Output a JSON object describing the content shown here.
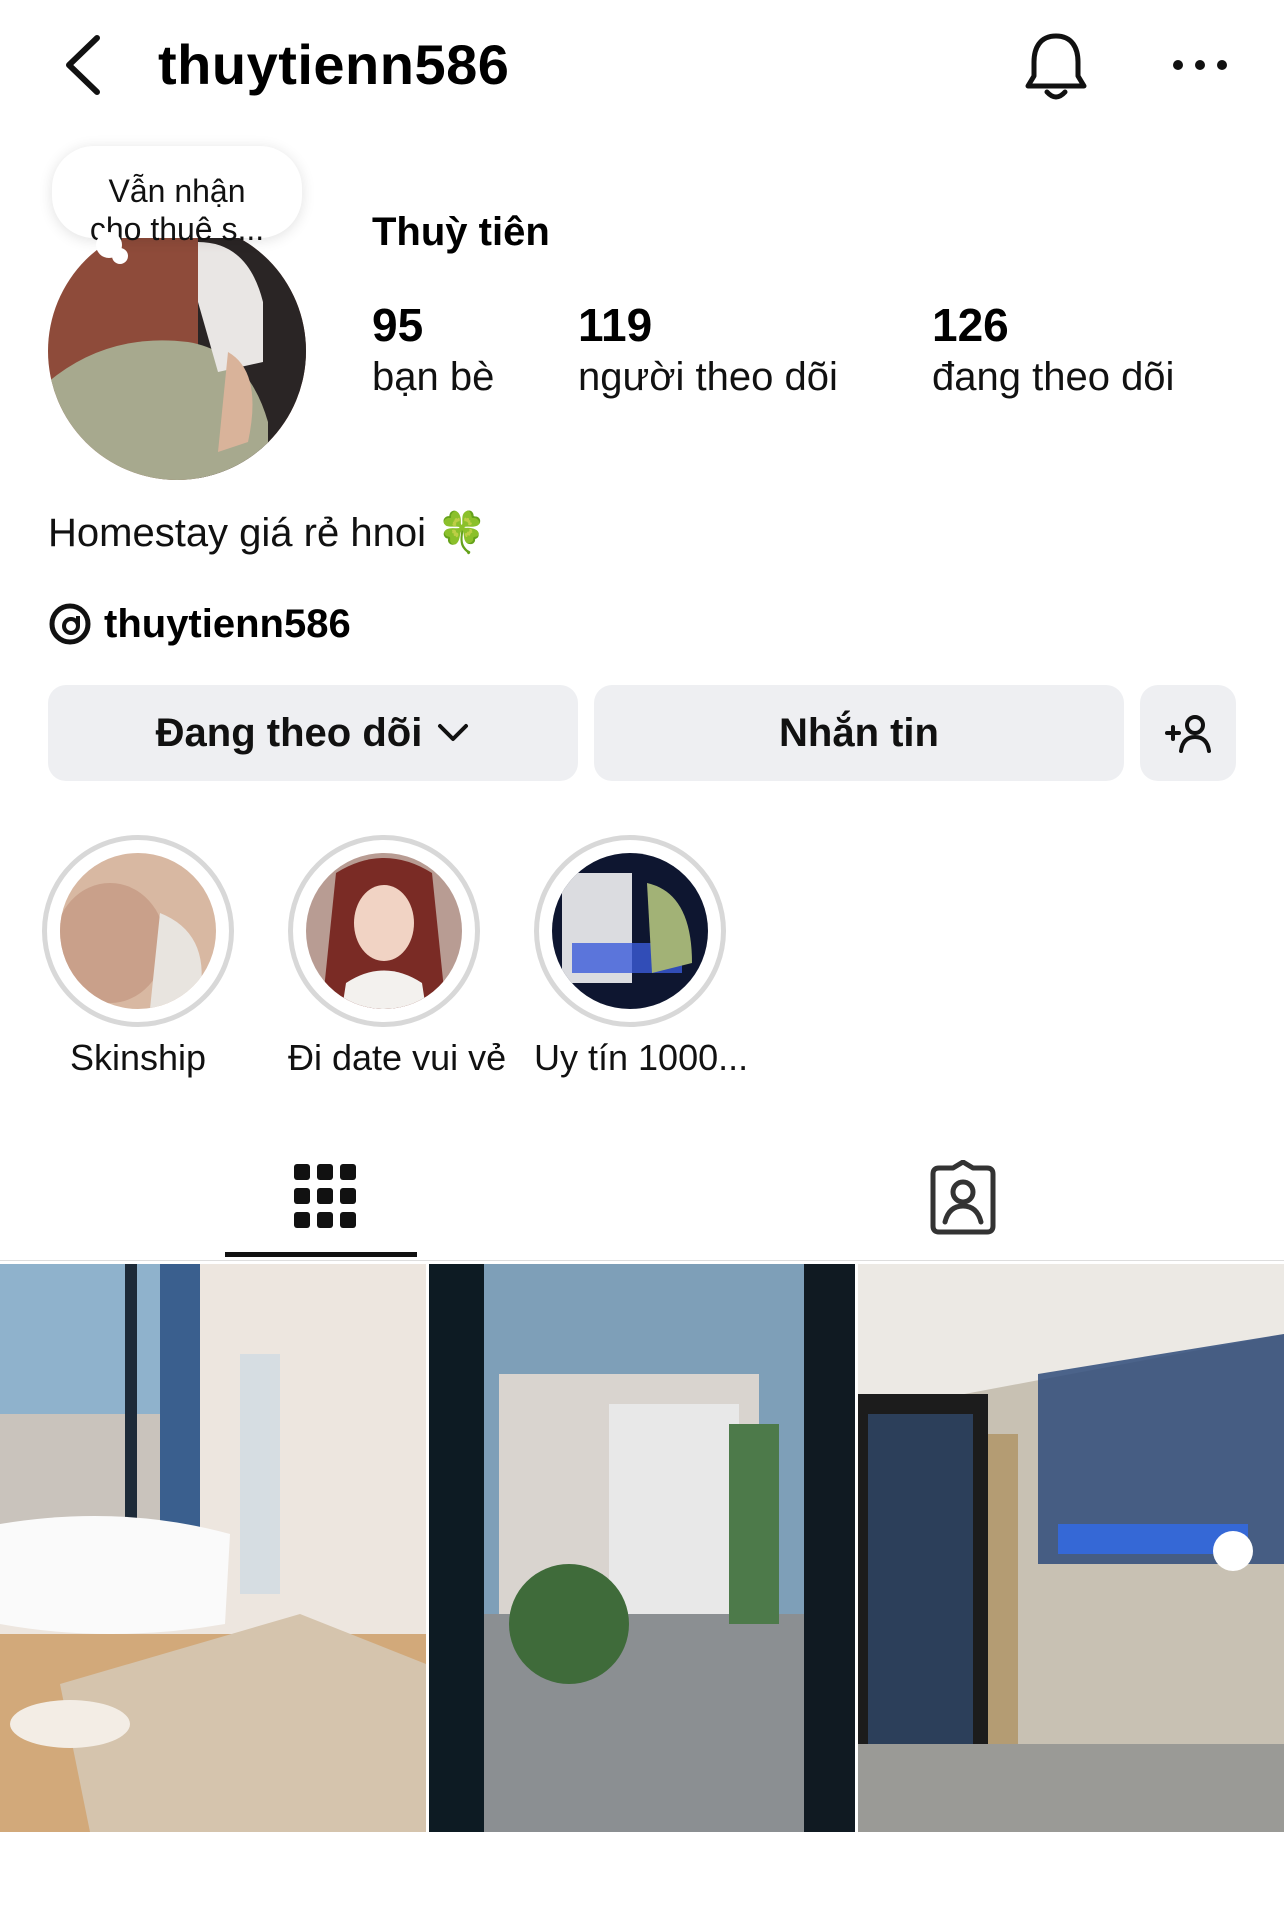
{
  "header": {
    "username": "thuytienn586",
    "icons": [
      "back-icon",
      "bell-icon",
      "more-icon"
    ]
  },
  "profile": {
    "note_line1": "Vẫn nhận",
    "note_line2": "cho thuê s...",
    "display_name": "Thuỳ tiên",
    "stats": [
      {
        "count": "95",
        "label": "bạn bè"
      },
      {
        "count": "119",
        "label": "người theo dõi"
      },
      {
        "count": "126",
        "label": "đang theo dõi"
      }
    ],
    "bio": "Homestay giá rẻ hnoi 🍀",
    "threads_handle": "thuytienn586"
  },
  "actions": {
    "following_label": "Đang theo dõi",
    "message_label": "Nhắn tin"
  },
  "highlights": [
    {
      "label": "Skinship"
    },
    {
      "label": "Đi date vui vẻ"
    },
    {
      "label": "Uy tín 1000..."
    }
  ],
  "tabs": {
    "active": "grid",
    "icons": [
      "grid-icon",
      "tagged-icon"
    ]
  },
  "colors": {
    "button_bg": "#eeeff2",
    "ring": "#d8d8d8",
    "text": "#111111"
  }
}
